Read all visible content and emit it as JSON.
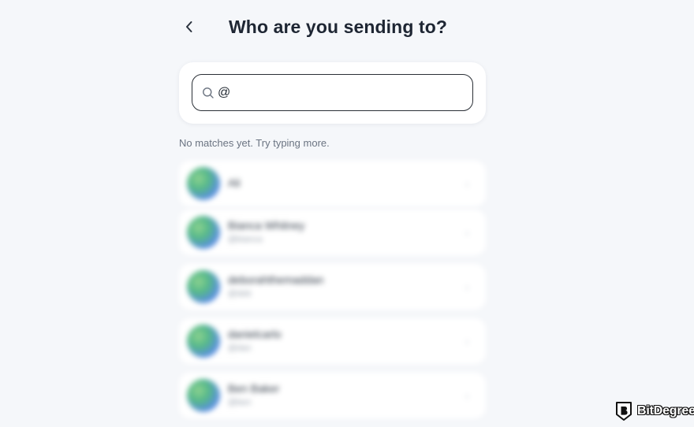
{
  "header": {
    "title": "Who are you sending to?",
    "back_icon": "chevron-left-icon"
  },
  "search": {
    "value": "@",
    "icon": "search-icon"
  },
  "hint": "No matches yet. Try typing more.",
  "recipients": [
    {
      "name": "Ali",
      "handle": ""
    },
    {
      "name": "Bianca Whitney",
      "handle": "@bianca"
    },
    {
      "name": "deborahthemaddan",
      "handle": "@deb"
    },
    {
      "name": "danielcarlo",
      "handle": "@dan"
    },
    {
      "name": "Ben Baker",
      "handle": "@ben"
    }
  ],
  "brand": {
    "name": "BitDegree",
    "icon": "bitdegree-shield-icon"
  },
  "colors": {
    "background": "#f5f7fa",
    "card": "#ffffff",
    "input_border": "#2a2f36",
    "title_text": "#1e2633",
    "hint_text": "#6b7482"
  }
}
